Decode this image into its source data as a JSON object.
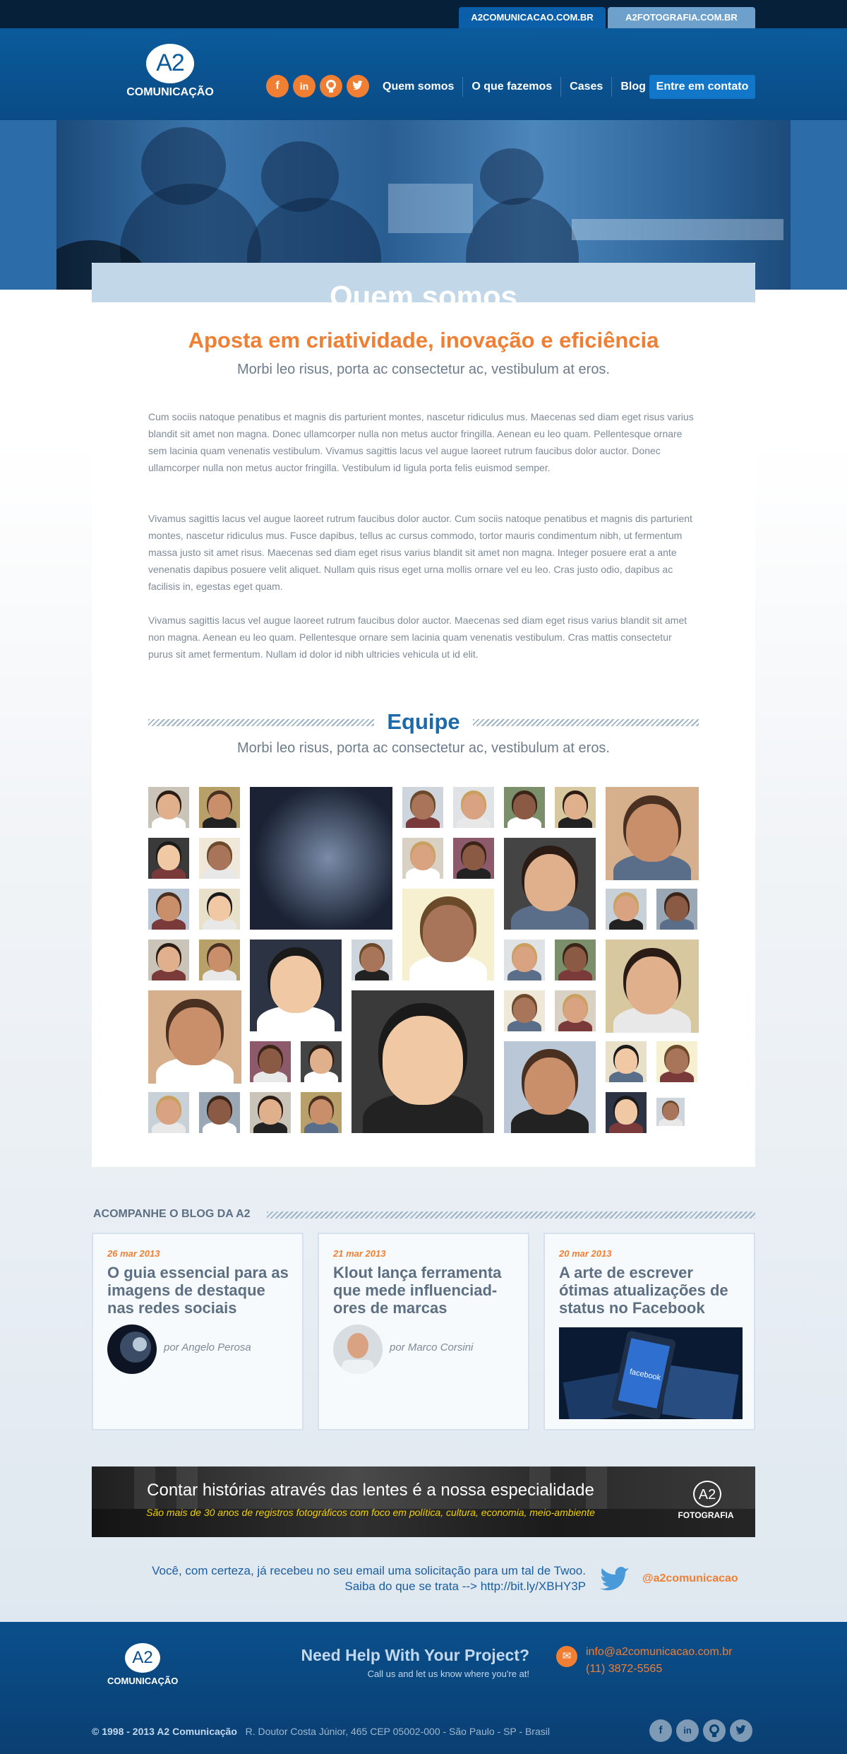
{
  "topbar": {
    "tab1": "A2COMUNICACAO.COM.BR",
    "tab2": "A2FOTOGRAFIA.COM.BR"
  },
  "header": {
    "logo_mark": "A2",
    "logo_name": "COMUNICAÇÃO",
    "social": [
      "facebook-icon",
      "linkedin-icon",
      "github-icon",
      "twitter-icon"
    ],
    "nav": [
      "Quem somos",
      "O que fazemos",
      "Cases",
      "Blog"
    ],
    "cta": "Entre em contato"
  },
  "about": {
    "title": "Quem somos",
    "headline": "Aposta em criatividade, inovação e eficiência",
    "subline": "Morbi leo risus, porta ac consectetur ac, vestibulum at eros.",
    "paragraphs": [
      "Cum sociis natoque penatibus et magnis dis parturient montes, nascetur ridiculus mus. Maecenas sed diam eget risus varius blandit sit amet non magna. Donec ullamcorper nulla non metus auctor fringilla. Aenean eu leo quam. Pellentesque ornare sem lacinia quam venenatis vestibulum. Vivamus sagittis lacus vel augue laoreet rutrum faucibus dolor auctor. Donec ullamcorper nulla non metus auctor fringilla. Vestibulum id ligula porta felis euismod semper.",
      "Vivamus sagittis lacus vel augue laoreet rutrum faucibus dolor auctor. Cum sociis natoque penatibus et magnis dis parturient montes, nascetur ridiculus mus. Fusce dapibus, tellus ac cursus commodo, tortor mauris condimentum nibh, ut fermentum massa justo sit amet risus. Maecenas sed diam eget risus varius blandit sit amet non magna. Integer posuere erat a ante venenatis dapibus posuere velit aliquet. Nullam quis risus eget urna mollis ornare vel eu leo. Cras justo odio, dapibus ac facilisis in, egestas eget quam.",
      "Vivamus sagittis lacus vel augue laoreet rutrum faucibus dolor auctor. Maecenas sed diam eget risus varius blandit sit amet non magna. Aenean eu leo quam. Pellentesque ornare sem lacinia quam venenatis vestibulum. Cras mattis consectetur purus sit amet fermentum. Nullam id dolor id nibh ultricies vehicula ut id elit."
    ]
  },
  "team": {
    "title": "Equipe",
    "subline": "Morbi leo risus, porta ac consectetur ac, vestibulum at eros."
  },
  "blog": {
    "label": "ACOMPANHE O BLOG DA A2",
    "posts": [
      {
        "date": "26 mar 2013",
        "title": "O guia essencial para as imagens de destaque nas redes sociais",
        "author": "por Angelo Perosa"
      },
      {
        "date": "21 mar 2013",
        "title": "Klout lança ferramenta que mede influenciad-ores de marcas",
        "author": "por Marco Corsini"
      },
      {
        "date": "20 mar 2013",
        "title": "A arte de escrever ótimas atualizações de status no Facebook",
        "thumb_text": "facebook"
      }
    ]
  },
  "promo": {
    "title": "Contar histórias através das lentes é a nossa especialidade",
    "subtitle": "São mais de 30 anos de registros fotográficos com foco em política, cultura, economia, meio-ambiente",
    "logo_mark": "A2",
    "logo_name": "FOTOGRAFIA"
  },
  "tweet": {
    "line1": "Você, com certeza, já recebeu no seu email uma solicitação para um tal de Twoo.",
    "line2": "Saiba do que se trata --> http://bit.ly/XBHY3P",
    "handle": "@a2comunicacao"
  },
  "footer": {
    "logo_mark": "A2",
    "logo_name": "COMUNICAÇÃO",
    "help_title": "Need Help With Your Project?",
    "help_sub": "Call us and let us know where you're at!",
    "email": "info@a2comunicacao.com.br",
    "phone": "(11) 3872-5565",
    "copyright": "© 1998 - 2013 A2 Comunicação",
    "address": "R. Doutor Costa Júnior, 465 CEP 05002-000 - São Paulo - SP - Brasil"
  },
  "colors": {
    "accent": "#f07f33",
    "brand_blue": "#0b5b9c",
    "link_blue": "#1d6aaa"
  }
}
